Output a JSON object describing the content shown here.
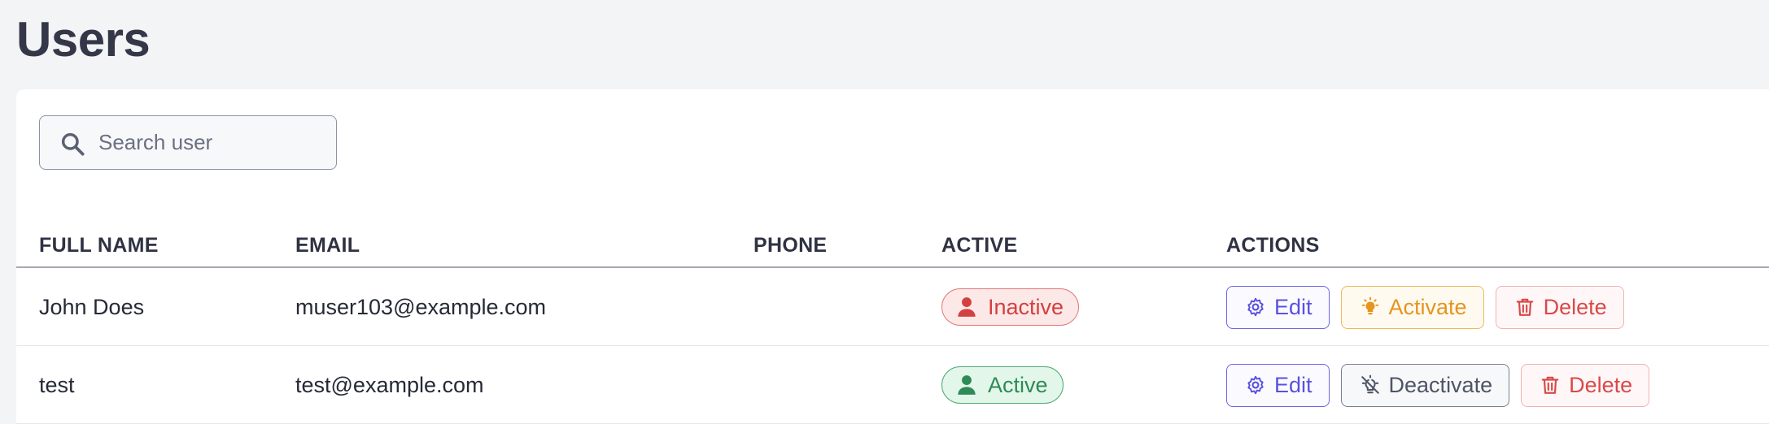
{
  "page": {
    "title": "Users"
  },
  "search": {
    "placeholder": "Search user",
    "value": ""
  },
  "table": {
    "headers": {
      "full_name": "FULL NAME",
      "email": "EMAIL",
      "phone": "PHONE",
      "active": "ACTIVE",
      "actions": "ACTIONS"
    },
    "rows": [
      {
        "full_name": "John Does",
        "email": "muser103@example.com",
        "phone": "",
        "status": "Inactive",
        "status_color": "#d2403f",
        "actions": {
          "edit": "Edit",
          "toggle": "Activate",
          "delete": "Delete"
        }
      },
      {
        "full_name": "test",
        "email": "test@example.com",
        "phone": "",
        "status": "Active",
        "status_color": "#2e8b57",
        "actions": {
          "edit": "Edit",
          "toggle": "Deactivate",
          "delete": "Delete"
        }
      }
    ]
  },
  "colors": {
    "edit": "#5a51de",
    "activate": "#e5951e",
    "deactivate": "#4f5566",
    "delete": "#d9494a"
  },
  "icons": {
    "search": "search-icon",
    "user": "user-icon",
    "edit": "gear-icon",
    "activate": "lightbulb-icon",
    "deactivate": "lightbulb-off-icon",
    "delete": "trash-icon"
  }
}
